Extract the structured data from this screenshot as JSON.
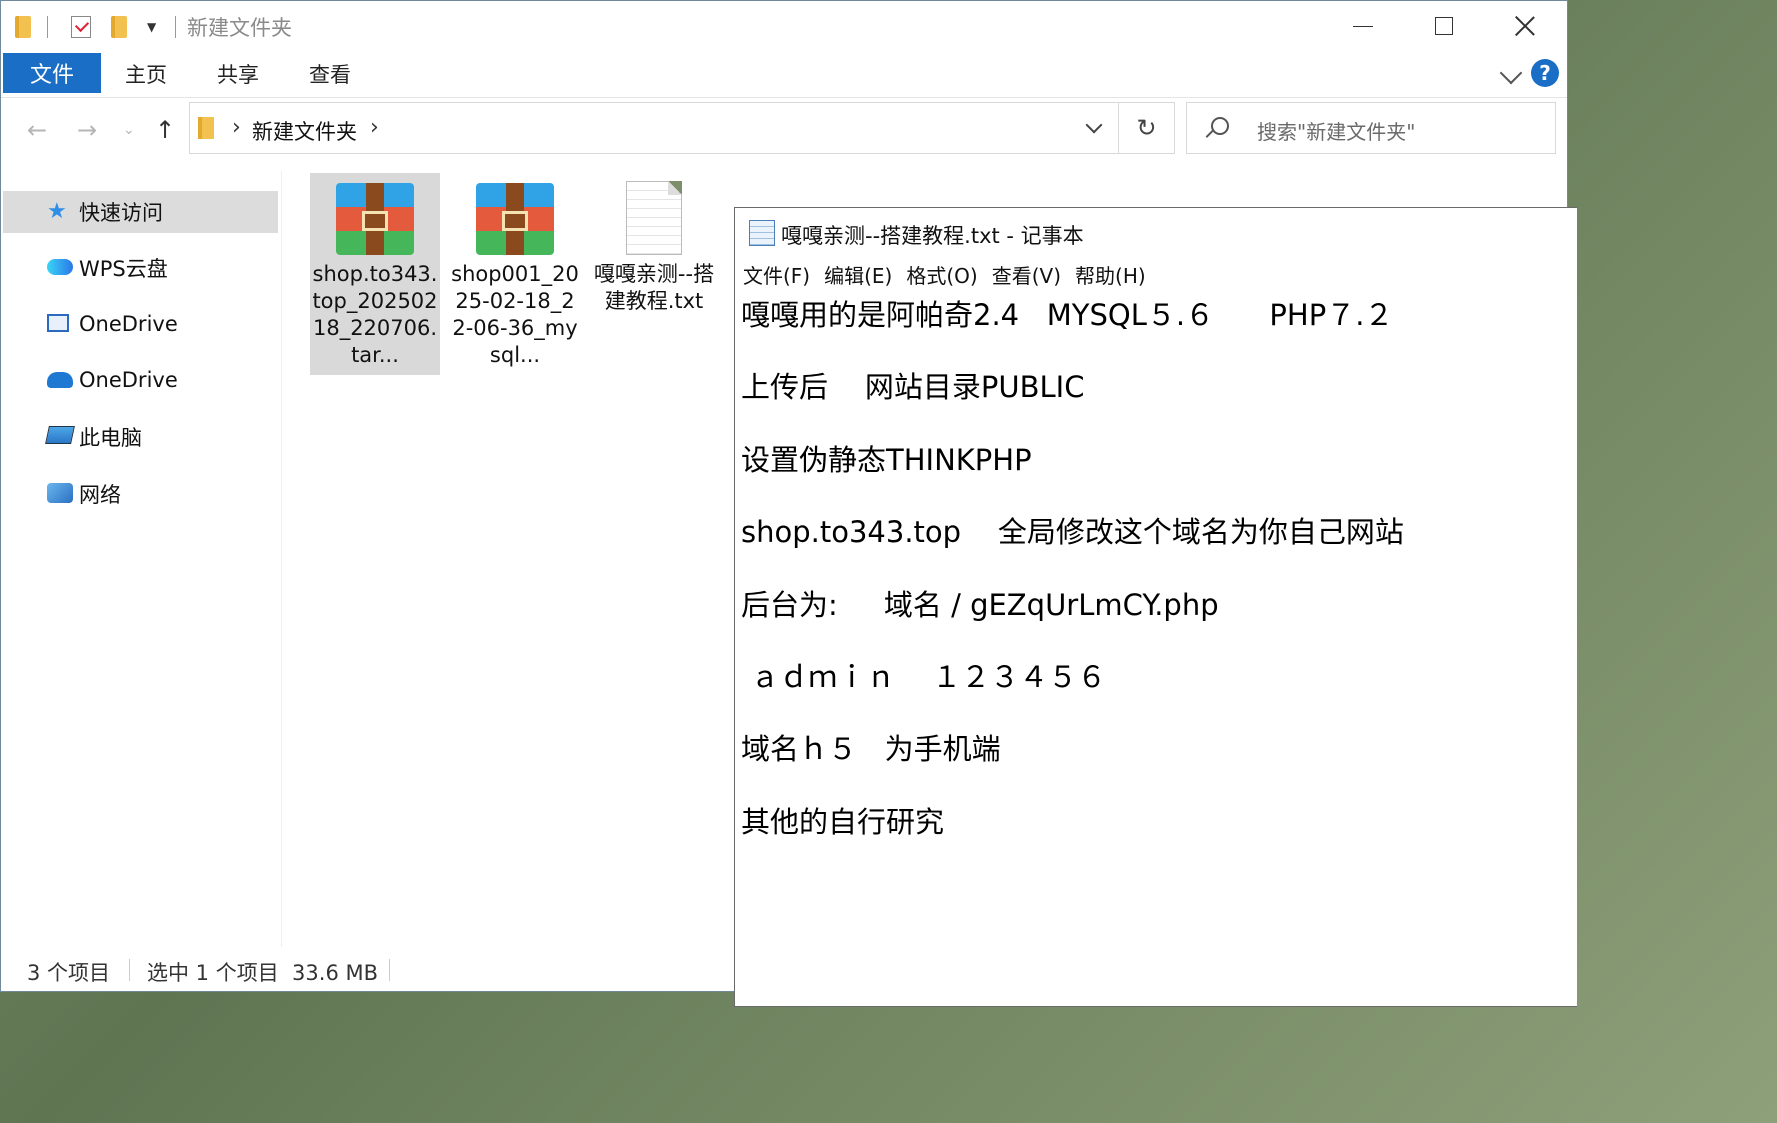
{
  "explorer": {
    "title": "新建文件夹",
    "ribbon_tabs": [
      "文件",
      "主页",
      "共享",
      "查看"
    ],
    "breadcrumb": "新建文件夹",
    "search_placeholder": "搜索\"新建文件夹\"",
    "sidebar": [
      {
        "label": "快速访问",
        "icon": "star-icon",
        "active": true
      },
      {
        "label": "WPS云盘",
        "icon": "wps-cloud-icon"
      },
      {
        "label": "OneDrive",
        "icon": "onedrive-icon"
      },
      {
        "label": "OneDrive",
        "icon": "onedrive-cloud-icon"
      },
      {
        "label": "此电脑",
        "icon": "computer-icon"
      },
      {
        "label": "网络",
        "icon": "network-icon"
      }
    ],
    "files": [
      {
        "name": "shop.to343.top_20250218_220706.tar...",
        "type": "archive",
        "selected": true
      },
      {
        "name": "shop001_2025-02-18_22-06-36_mysql...",
        "type": "archive"
      },
      {
        "name": "嘎嘎亲测--搭建教程.txt",
        "type": "text"
      }
    ],
    "status": {
      "item_count": "3 个项目",
      "selection": "选中 1 个项目  33.6 MB"
    }
  },
  "notepad": {
    "title": "嘎嘎亲测--搭建教程.txt - 记事本",
    "menu": [
      "文件(F)",
      "编辑(E)",
      "格式(O)",
      "查看(V)",
      "帮助(H)"
    ],
    "lines": [
      "嘎嘎用的是阿帕奇2.4   MYSQL５.６      PHP７.２",
      "上传后    网站目录PUBLIC",
      "设置伪静态THINKPHP",
      "shop.to343.top    全局修改这个域名为你自己网站",
      "后台为:     域名 / gEZqUrLmCY.php",
      " ａｄｍｉｎ    １２３４５６",
      "域名ｈ５   为手机端",
      "其他的自行研究"
    ]
  },
  "colors": {
    "accent": "#1a6ec5",
    "selected_item": "#d9d9d9"
  }
}
